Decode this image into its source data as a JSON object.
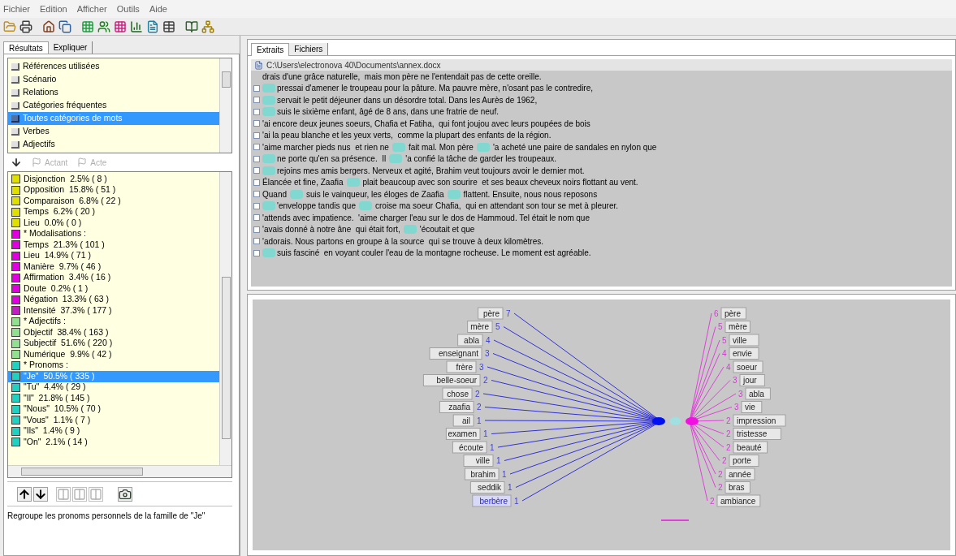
{
  "menu": [
    "Fichier",
    "Edition",
    "Afficher",
    "Outils",
    "Aide"
  ],
  "left_tabs": [
    {
      "label": "Résultats",
      "selected": true
    },
    {
      "label": "Expliquer",
      "selected": false
    }
  ],
  "analysis_list": [
    {
      "label": "Références utilisées",
      "selected": false
    },
    {
      "label": "Scénario",
      "selected": false
    },
    {
      "label": "Relations",
      "selected": false
    },
    {
      "label": "Catégories fréquentes",
      "selected": false
    },
    {
      "label": "Toutes catégories de mots",
      "selected": true
    },
    {
      "label": "Verbes",
      "selected": false
    },
    {
      "label": "Adjectifs",
      "selected": false
    }
  ],
  "mode_buttons": [
    {
      "label": "Actant",
      "disabled": true
    },
    {
      "label": "Acte",
      "disabled": true
    }
  ],
  "categories": [
    {
      "label": "Disjonction  2.5% ( 8 )",
      "color": "#e0e000",
      "selected": false
    },
    {
      "label": "Opposition  15.8% ( 51 )",
      "color": "#e0e000",
      "selected": false
    },
    {
      "label": "Comparaison  6.8% ( 22 )",
      "color": "#e0e000",
      "selected": false
    },
    {
      "label": "Temps  6.2% ( 20 )",
      "color": "#e0e000",
      "selected": false
    },
    {
      "label": "Lieu  0.0% ( 0 )",
      "color": "#e0e000",
      "selected": false
    },
    {
      "label": "* Modalisations :",
      "color": "#e000e0",
      "selected": false
    },
    {
      "label": "Temps  21.3% ( 101 )",
      "color": "#e000e0",
      "selected": false
    },
    {
      "label": "Lieu  14.9% ( 71 )",
      "color": "#e000e0",
      "selected": false
    },
    {
      "label": "Manière  9.7% ( 46 )",
      "color": "#e000e0",
      "selected": false
    },
    {
      "label": "Affirmation  3.4% ( 16 )",
      "color": "#e000e0",
      "selected": false
    },
    {
      "label": "Doute  0.2% ( 1 )",
      "color": "#e000e0",
      "selected": false
    },
    {
      "label": "Négation  13.3% ( 63 )",
      "color": "#e000e0",
      "selected": false
    },
    {
      "label": "Intensité  37.3% ( 177 )",
      "color": "#c020c0",
      "selected": false
    },
    {
      "label": "* Adjectifs :",
      "color": "#90e090",
      "selected": false
    },
    {
      "label": "Objectif  38.4% ( 163 )",
      "color": "#90e090",
      "selected": false
    },
    {
      "label": "Subjectif  51.6% ( 220 )",
      "color": "#90e090",
      "selected": false
    },
    {
      "label": "Numérique  9.9% ( 42 )",
      "color": "#90e090",
      "selected": false
    },
    {
      "label": "* Pronoms :",
      "color": "#20d0c0",
      "selected": false
    },
    {
      "label": "\"Je\"  50.5% ( 335 )",
      "color": "#20d0c0",
      "selected": true
    },
    {
      "label": "\"Tu\"  4.4% ( 29 )",
      "color": "#20d0c0",
      "selected": false
    },
    {
      "label": "\"Il\"  21.8% ( 145 )",
      "color": "#20d0c0",
      "selected": false
    },
    {
      "label": "\"Nous\"  10.5% ( 70 )",
      "color": "#20d0c0",
      "selected": false
    },
    {
      "label": "\"Vous\"  1.1% ( 7 )",
      "color": "#20d0c0",
      "selected": false
    },
    {
      "label": "\"Ils\"  1.4% ( 9 )",
      "color": "#20d0c0",
      "selected": false
    },
    {
      "label": "\"On\"  2.1% ( 14 )",
      "color": "#20d0c0",
      "selected": false
    }
  ],
  "description": "Regroupe les pronoms personnels de la famille de \"Je\"",
  "right_tabs": [
    {
      "label": "Extraits",
      "selected": true
    },
    {
      "label": "Fichiers",
      "selected": false
    }
  ],
  "file_path": "C:\\Users\\electronova 40\\Documents\\annex.docx",
  "extracts": [
    {
      "expander": false,
      "lead_mark": false,
      "parts": [
        "drais d'une grâce naturelle,  mais mon père ne l'entendait pas de cette oreille."
      ]
    },
    {
      "expander": true,
      "lead_mark": true,
      "parts": [
        "pressai d'amener le troupeau pour la pâture. Ma pauvre mère, n'osant pas le contredire,"
      ]
    },
    {
      "expander": true,
      "lead_mark": true,
      "parts": [
        "servait le petit déjeuner dans un désordre total. Dans les Aurès de 1962,"
      ]
    },
    {
      "expander": true,
      "lead_mark": true,
      "parts": [
        "suis le sixième enfant, âgé de 8 ans, dans une fratrie de neuf."
      ]
    },
    {
      "expander": true,
      "lead_mark": false,
      "parts": [
        "'ai encore deux jeunes soeurs, Chafia et Fatiha,  qui font joujou avec leurs poupées de bois"
      ]
    },
    {
      "expander": true,
      "lead_mark": false,
      "parts": [
        "'ai la peau blanche et les yeux verts,  comme la plupart des enfants de la région."
      ]
    },
    {
      "expander": true,
      "lead_mark": false,
      "parts": [
        "'aime marcher pieds nus  et rien ne",
        "fait mal. Mon père",
        "'a acheté une paire de sandales en nylon que"
      ]
    },
    {
      "expander": true,
      "lead_mark": true,
      "parts": [
        "ne porte qu'en sa présence.  Il",
        "'a confié la tâche de garder les troupeaux."
      ]
    },
    {
      "expander": true,
      "lead_mark": true,
      "parts": [
        "rejoins mes amis bergers. Nerveux et agité, Brahim veut toujours avoir le dernier mot."
      ]
    },
    {
      "expander": true,
      "lead_mark": false,
      "parts": [
        "Élancée et fine, Zaafia",
        "plait beaucoup avec son sourire  et ses beaux cheveux noirs flottant au vent."
      ]
    },
    {
      "expander": true,
      "lead_mark": false,
      "parts": [
        "Quand",
        "suis le vainqueur, les éloges de Zaafia",
        "flattent. Ensuite, nous nous reposons"
      ]
    },
    {
      "expander": true,
      "lead_mark": true,
      "parts": [
        "'enveloppe tandis que",
        "croise ma soeur Chafia,  qui en attendant son tour se met à pleurer."
      ]
    },
    {
      "expander": true,
      "lead_mark": false,
      "parts": [
        "'attends avec impatience.  'aime charger l'eau sur le dos de Hammoud. Tel était le nom que"
      ]
    },
    {
      "expander": true,
      "lead_mark": false,
      "parts": [
        "'avais donné à notre âne  qui était fort,",
        "'écoutait et que"
      ]
    },
    {
      "expander": true,
      "lead_mark": false,
      "parts": [
        "'adorais. Nous partons en groupe à la source  qui se trouve à deux kilomètres."
      ]
    },
    {
      "expander": true,
      "lead_mark": true,
      "parts": [
        "suis fasciné  en voyant couler l'eau de la montagne rocheuse. Le moment est agréable."
      ]
    }
  ],
  "left_words": [
    {
      "word": "père",
      "count": "7"
    },
    {
      "word": "mère",
      "count": "5"
    },
    {
      "word": "abla",
      "count": "4"
    },
    {
      "word": "enseignant",
      "count": "3"
    },
    {
      "word": "frère",
      "count": "3"
    },
    {
      "word": "belle-soeur",
      "count": "2"
    },
    {
      "word": "chose",
      "count": "2"
    },
    {
      "word": "zaafia",
      "count": "2"
    },
    {
      "word": "ail",
      "count": "1"
    },
    {
      "word": "examen",
      "count": "1"
    },
    {
      "word": "écoute",
      "count": "1"
    },
    {
      "word": "ville",
      "count": "1"
    },
    {
      "word": "brahim",
      "count": "1"
    },
    {
      "word": "seddik",
      "count": "1"
    },
    {
      "word": "berbère",
      "count": "1",
      "selected": true
    }
  ],
  "right_words": [
    {
      "count": "6",
      "word": "père"
    },
    {
      "count": "5",
      "word": "mère"
    },
    {
      "count": "5",
      "word": "ville"
    },
    {
      "count": "4",
      "word": "envie"
    },
    {
      "count": "4",
      "word": "soeur"
    },
    {
      "count": "3",
      "word": "jour"
    },
    {
      "count": "3",
      "word": "abla"
    },
    {
      "count": "3",
      "word": "vie"
    },
    {
      "count": "2",
      "word": "impression"
    },
    {
      "count": "2",
      "word": "tristesse"
    },
    {
      "count": "2",
      "word": "beauté"
    },
    {
      "count": "2",
      "word": "porte"
    },
    {
      "count": "2",
      "word": "année"
    },
    {
      "count": "2",
      "word": "bras"
    },
    {
      "count": "2",
      "word": "ambiance"
    }
  ]
}
